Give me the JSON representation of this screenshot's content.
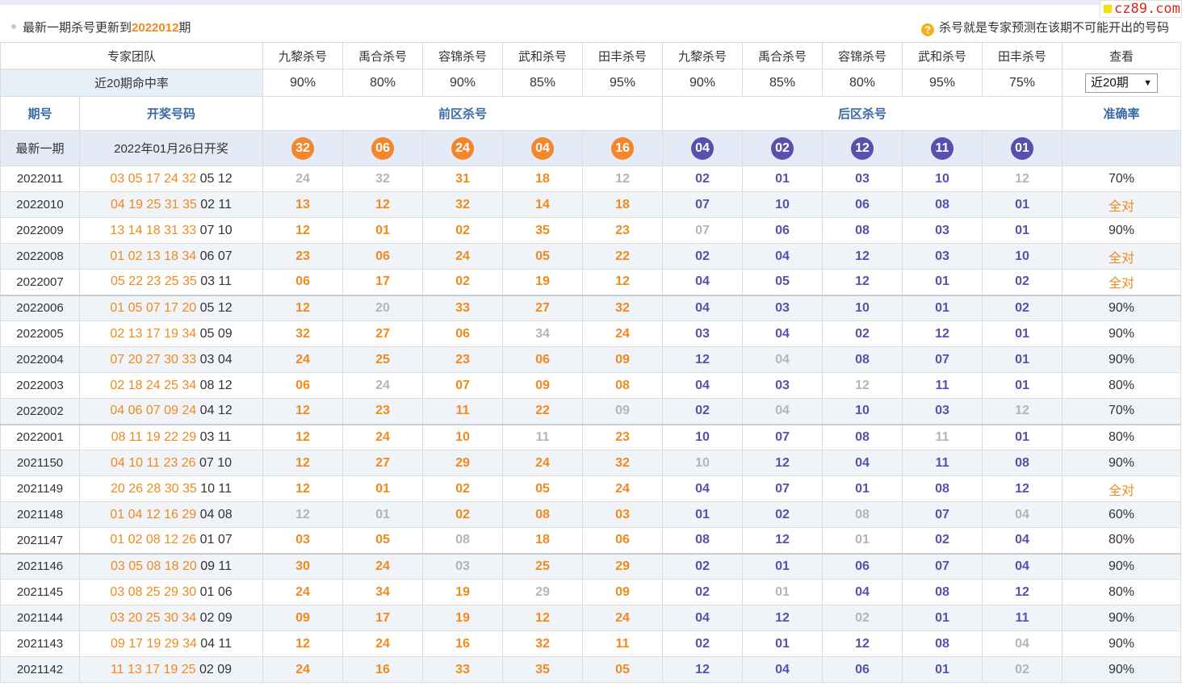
{
  "header": {
    "update_prefix": "最新一期杀号更新到",
    "update_issue": "2022012",
    "update_suffix": "期",
    "hint_icon": "?",
    "hint_text": "杀号就是专家预测在该期不可能开出的号码",
    "logo_text": "cz89.com"
  },
  "team_row": {
    "label": "专家团队",
    "experts": [
      "九黎杀号",
      "禹合杀号",
      "容锦杀号",
      "武和杀号",
      "田丰杀号",
      "九黎杀号",
      "禹合杀号",
      "容锦杀号",
      "武和杀号",
      "田丰杀号"
    ],
    "view_label": "查看"
  },
  "rate_row": {
    "label": "近20期命中率",
    "rates": [
      "90%",
      "80%",
      "90%",
      "85%",
      "95%",
      "90%",
      "85%",
      "80%",
      "95%",
      "75%"
    ],
    "select_value": "近20期"
  },
  "col_headers": {
    "issue": "期号",
    "draw": "开奖号码",
    "front": "前区杀号",
    "back": "后区杀号",
    "accuracy": "准确率"
  },
  "latest": {
    "label": "最新一期",
    "draw_date": "2022年01月26日开奖",
    "front": [
      "32",
      "06",
      "24",
      "04",
      "16"
    ],
    "back": [
      "04",
      "02",
      "12",
      "11",
      "01"
    ]
  },
  "rows": [
    {
      "issue": "2022011",
      "draw_front": "03 05 17 24 32",
      "draw_back": "05 12",
      "front": [
        "24",
        "32",
        "31",
        "18",
        "12"
      ],
      "front_hit": [
        true,
        true,
        false,
        false,
        true
      ],
      "back": [
        "02",
        "01",
        "03",
        "10",
        "12"
      ],
      "back_hit": [
        false,
        false,
        false,
        false,
        true
      ],
      "acc": "70%"
    },
    {
      "issue": "2022010",
      "draw_front": "04 19 25 31 35",
      "draw_back": "02 11",
      "front": [
        "13",
        "12",
        "32",
        "14",
        "18"
      ],
      "front_hit": [
        false,
        false,
        false,
        false,
        false
      ],
      "back": [
        "07",
        "10",
        "06",
        "08",
        "01"
      ],
      "back_hit": [
        false,
        false,
        false,
        false,
        false
      ],
      "acc": "全对"
    },
    {
      "issue": "2022009",
      "draw_front": "13 14 18 31 33",
      "draw_back": "07 10",
      "front": [
        "12",
        "01",
        "02",
        "35",
        "23"
      ],
      "front_hit": [
        false,
        false,
        false,
        false,
        false
      ],
      "back": [
        "07",
        "06",
        "08",
        "03",
        "01"
      ],
      "back_hit": [
        true,
        false,
        false,
        false,
        false
      ],
      "acc": "90%"
    },
    {
      "issue": "2022008",
      "draw_front": "01 02 13 18 34",
      "draw_back": "06 07",
      "front": [
        "23",
        "06",
        "24",
        "05",
        "22"
      ],
      "front_hit": [
        false,
        false,
        false,
        false,
        false
      ],
      "back": [
        "02",
        "04",
        "12",
        "03",
        "10"
      ],
      "back_hit": [
        false,
        false,
        false,
        false,
        false
      ],
      "acc": "全对"
    },
    {
      "issue": "2022007",
      "draw_front": "05 22 23 25 35",
      "draw_back": "03 11",
      "front": [
        "06",
        "17",
        "02",
        "19",
        "12"
      ],
      "front_hit": [
        false,
        false,
        false,
        false,
        false
      ],
      "back": [
        "04",
        "05",
        "12",
        "01",
        "02"
      ],
      "back_hit": [
        false,
        false,
        false,
        false,
        false
      ],
      "acc": "全对"
    },
    {
      "issue": "2022006",
      "draw_front": "01 05 07 17 20",
      "draw_back": "05 12",
      "front": [
        "12",
        "20",
        "33",
        "27",
        "32"
      ],
      "front_hit": [
        false,
        true,
        false,
        false,
        false
      ],
      "back": [
        "04",
        "03",
        "10",
        "01",
        "02"
      ],
      "back_hit": [
        false,
        false,
        false,
        false,
        false
      ],
      "acc": "90%"
    },
    {
      "issue": "2022005",
      "draw_front": "02 13 17 19 34",
      "draw_back": "05 09",
      "front": [
        "32",
        "27",
        "06",
        "34",
        "24"
      ],
      "front_hit": [
        false,
        false,
        false,
        true,
        false
      ],
      "back": [
        "03",
        "04",
        "02",
        "12",
        "01"
      ],
      "back_hit": [
        false,
        false,
        false,
        false,
        false
      ],
      "acc": "90%"
    },
    {
      "issue": "2022004",
      "draw_front": "07 20 27 30 33",
      "draw_back": "03 04",
      "front": [
        "24",
        "25",
        "23",
        "06",
        "09"
      ],
      "front_hit": [
        false,
        false,
        false,
        false,
        false
      ],
      "back": [
        "12",
        "04",
        "08",
        "07",
        "01"
      ],
      "back_hit": [
        false,
        true,
        false,
        false,
        false
      ],
      "acc": "90%"
    },
    {
      "issue": "2022003",
      "draw_front": "02 18 24 25 34",
      "draw_back": "08 12",
      "front": [
        "06",
        "24",
        "07",
        "09",
        "08"
      ],
      "front_hit": [
        false,
        true,
        false,
        false,
        false
      ],
      "back": [
        "04",
        "03",
        "12",
        "11",
        "01"
      ],
      "back_hit": [
        false,
        false,
        true,
        false,
        false
      ],
      "acc": "80%"
    },
    {
      "issue": "2022002",
      "draw_front": "04 06 07 09 24",
      "draw_back": "04 12",
      "front": [
        "12",
        "23",
        "11",
        "22",
        "09"
      ],
      "front_hit": [
        false,
        false,
        false,
        false,
        true
      ],
      "back": [
        "02",
        "04",
        "10",
        "03",
        "12"
      ],
      "back_hit": [
        false,
        true,
        false,
        false,
        true
      ],
      "acc": "70%"
    },
    {
      "issue": "2022001",
      "draw_front": "08 11 19 22 29",
      "draw_back": "03 11",
      "front": [
        "12",
        "24",
        "10",
        "11",
        "23"
      ],
      "front_hit": [
        false,
        false,
        false,
        true,
        false
      ],
      "back": [
        "10",
        "07",
        "08",
        "11",
        "01"
      ],
      "back_hit": [
        false,
        false,
        false,
        true,
        false
      ],
      "acc": "80%"
    },
    {
      "issue": "2021150",
      "draw_front": "04 10 11 23 26",
      "draw_back": "07 10",
      "front": [
        "12",
        "27",
        "29",
        "24",
        "32"
      ],
      "front_hit": [
        false,
        false,
        false,
        false,
        false
      ],
      "back": [
        "10",
        "12",
        "04",
        "11",
        "08"
      ],
      "back_hit": [
        true,
        false,
        false,
        false,
        false
      ],
      "acc": "90%"
    },
    {
      "issue": "2021149",
      "draw_front": "20 26 28 30 35",
      "draw_back": "10 11",
      "front": [
        "12",
        "01",
        "02",
        "05",
        "24"
      ],
      "front_hit": [
        false,
        false,
        false,
        false,
        false
      ],
      "back": [
        "04",
        "07",
        "01",
        "08",
        "12"
      ],
      "back_hit": [
        false,
        false,
        false,
        false,
        false
      ],
      "acc": "全对"
    },
    {
      "issue": "2021148",
      "draw_front": "01 04 12 16 29",
      "draw_back": "04 08",
      "front": [
        "12",
        "01",
        "02",
        "08",
        "03"
      ],
      "front_hit": [
        true,
        true,
        false,
        false,
        false
      ],
      "back": [
        "01",
        "02",
        "08",
        "07",
        "04"
      ],
      "back_hit": [
        false,
        false,
        true,
        false,
        true
      ],
      "acc": "60%"
    },
    {
      "issue": "2021147",
      "draw_front": "01 02 08 12 26",
      "draw_back": "01 07",
      "front": [
        "03",
        "05",
        "08",
        "18",
        "06"
      ],
      "front_hit": [
        false,
        false,
        true,
        false,
        false
      ],
      "back": [
        "08",
        "12",
        "01",
        "02",
        "04"
      ],
      "back_hit": [
        false,
        false,
        true,
        false,
        false
      ],
      "acc": "80%"
    },
    {
      "issue": "2021146",
      "draw_front": "03 05 08 18 20",
      "draw_back": "09 11",
      "front": [
        "30",
        "24",
        "03",
        "25",
        "29"
      ],
      "front_hit": [
        false,
        false,
        true,
        false,
        false
      ],
      "back": [
        "02",
        "01",
        "06",
        "07",
        "04"
      ],
      "back_hit": [
        false,
        false,
        false,
        false,
        false
      ],
      "acc": "90%"
    },
    {
      "issue": "2021145",
      "draw_front": "03 08 25 29 30",
      "draw_back": "01 06",
      "front": [
        "24",
        "34",
        "19",
        "29",
        "09"
      ],
      "front_hit": [
        false,
        false,
        false,
        true,
        false
      ],
      "back": [
        "02",
        "01",
        "04",
        "08",
        "12"
      ],
      "back_hit": [
        false,
        true,
        false,
        false,
        false
      ],
      "acc": "80%"
    },
    {
      "issue": "2021144",
      "draw_front": "03 20 25 30 34",
      "draw_back": "02 09",
      "front": [
        "09",
        "17",
        "19",
        "12",
        "24"
      ],
      "front_hit": [
        false,
        false,
        false,
        false,
        false
      ],
      "back": [
        "04",
        "12",
        "02",
        "01",
        "11"
      ],
      "back_hit": [
        false,
        false,
        true,
        false,
        false
      ],
      "acc": "90%"
    },
    {
      "issue": "2021143",
      "draw_front": "09 17 19 29 34",
      "draw_back": "04 11",
      "front": [
        "12",
        "24",
        "16",
        "32",
        "11"
      ],
      "front_hit": [
        false,
        false,
        false,
        false,
        false
      ],
      "back": [
        "02",
        "01",
        "12",
        "08",
        "04"
      ],
      "back_hit": [
        false,
        false,
        false,
        false,
        true
      ],
      "acc": "90%"
    },
    {
      "issue": "2021142",
      "draw_front": "11 13 17 19 25",
      "draw_back": "02 09",
      "front": [
        "24",
        "16",
        "33",
        "35",
        "05"
      ],
      "front_hit": [
        false,
        false,
        false,
        false,
        false
      ],
      "back": [
        "12",
        "04",
        "06",
        "01",
        "02"
      ],
      "back_hit": [
        false,
        false,
        false,
        false,
        true
      ],
      "acc": "90%"
    }
  ],
  "colors": {
    "front_accent": "#f08a1d",
    "back_accent": "#5b4fad",
    "miss_gray": "#b5b5b5",
    "header_blue": "#3a6aa5"
  }
}
